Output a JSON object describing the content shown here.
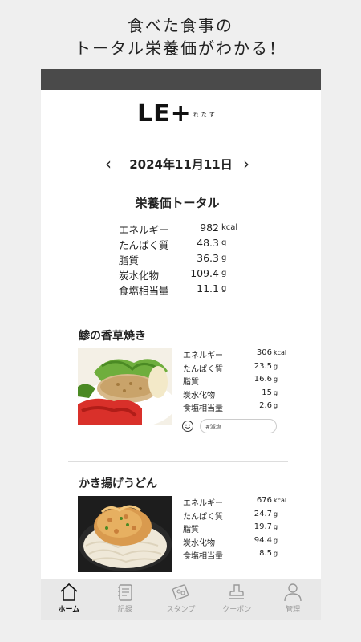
{
  "promo": {
    "line1": "食べた食事の",
    "line2": "トータル栄養価がわかる！"
  },
  "logo": {
    "main": "LE+",
    "sub": "れたす"
  },
  "date": {
    "prev_icon": "chevron-left-icon",
    "next_icon": "chevron-right-icon",
    "text": "2024年11月11日"
  },
  "totals": {
    "title": "栄養価トータル",
    "rows": [
      {
        "label": "エネルギー",
        "value": "982",
        "unit": "kcal"
      },
      {
        "label": "たんぱく質",
        "value": "48.3",
        "unit": "g"
      },
      {
        "label": "脂質",
        "value": "36.3",
        "unit": "g"
      },
      {
        "label": "炭水化物",
        "value": "109.4",
        "unit": "g"
      },
      {
        "label": "食塩相当量",
        "value": "11.1",
        "unit": "g"
      }
    ]
  },
  "meals": [
    {
      "name": "鯵の香草焼き",
      "nutrients": [
        {
          "label": "エネルギー",
          "value": "306",
          "unit": "kcal"
        },
        {
          "label": "たんぱく質",
          "value": "23.5",
          "unit": "g"
        },
        {
          "label": "脂質",
          "value": "16.6",
          "unit": "g"
        },
        {
          "label": "炭水化物",
          "value": "15",
          "unit": "g"
        },
        {
          "label": "食塩相当量",
          "value": "2.6",
          "unit": "g"
        }
      ],
      "memo": "#減塩",
      "memo_icon": "smiley-face-icon"
    },
    {
      "name": "かき揚げうどん",
      "nutrients": [
        {
          "label": "エネルギー",
          "value": "676",
          "unit": "kcal"
        },
        {
          "label": "たんぱく質",
          "value": "24.7",
          "unit": "g"
        },
        {
          "label": "脂質",
          "value": "19.7",
          "unit": "g"
        },
        {
          "label": "炭水化物",
          "value": "94.4",
          "unit": "g"
        },
        {
          "label": "食塩相当量",
          "value": "8.5",
          "unit": "g"
        }
      ]
    }
  ],
  "tabs": [
    {
      "label": "ホーム",
      "icon": "home-icon",
      "active": true
    },
    {
      "label": "記録",
      "icon": "notebook-icon"
    },
    {
      "label": "スタンプ",
      "icon": "stamp-card-icon"
    },
    {
      "label": "クーポン",
      "icon": "coupon-stamp-icon"
    },
    {
      "label": "管理",
      "icon": "person-icon"
    }
  ],
  "colors": {
    "status_bar": "#4a4a4a",
    "background": "#efefef",
    "tab_bar": "#e8e8e8"
  }
}
